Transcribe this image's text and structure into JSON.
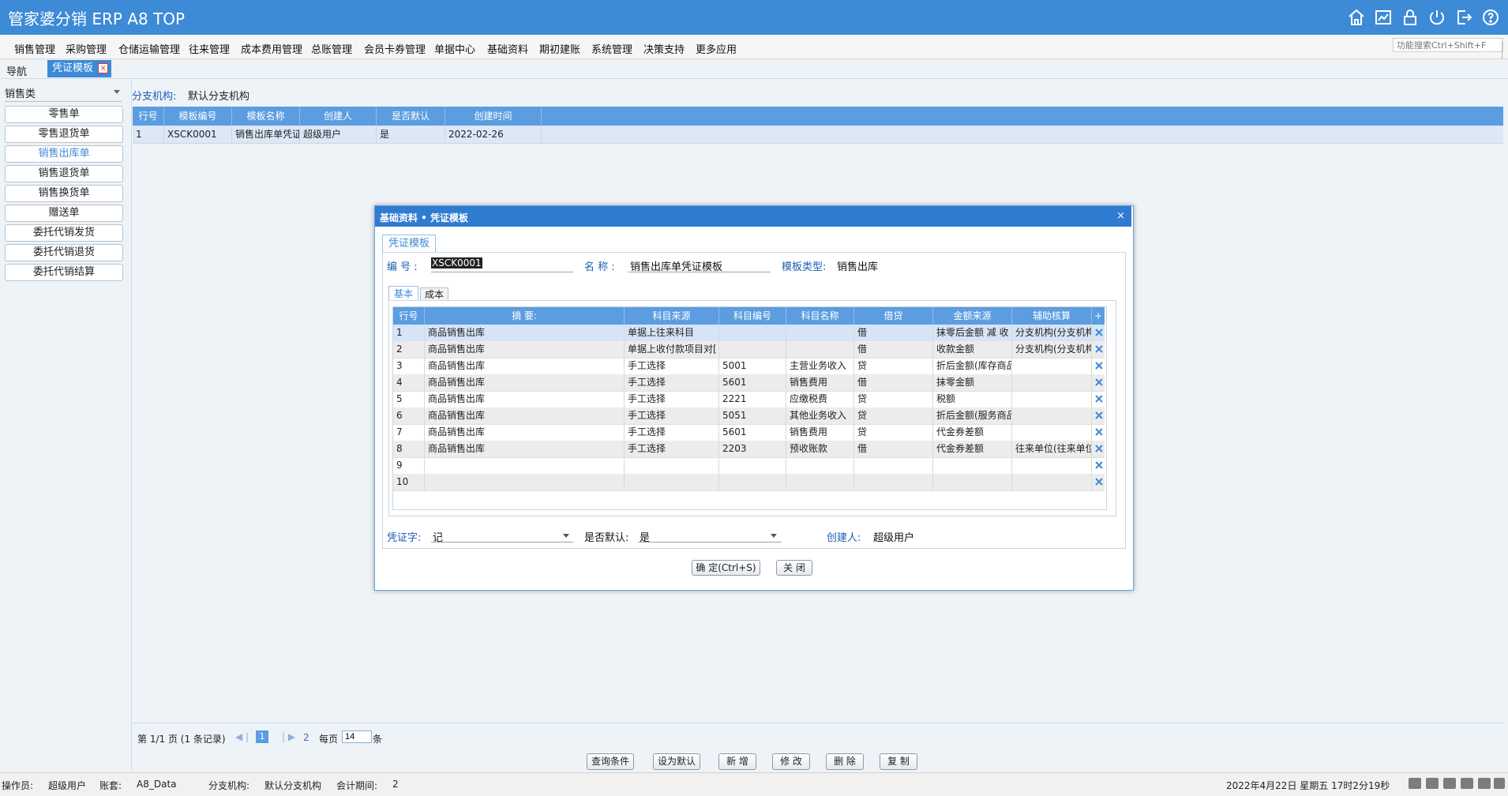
{
  "app": {
    "title": "管家婆分销 ERP A8 TOP"
  },
  "top_icons": [
    "home-icon",
    "chart-icon",
    "lock-icon",
    "power-icon",
    "exit-icon",
    "help-icon"
  ],
  "menu": [
    "销售管理",
    "采购管理",
    "仓储运输管理",
    "往来管理",
    "成本费用管理",
    "总账管理",
    "会员卡券管理",
    "单据中心",
    "基础资料",
    "期初建账",
    "系统管理",
    "决策支持",
    "更多应用"
  ],
  "search": {
    "placeholder": "功能搜索Ctrl+Shift+F"
  },
  "tabs": {
    "nav": "导航",
    "voucher": "凭证模板"
  },
  "left": {
    "category": "销售类",
    "buttons": [
      "零售单",
      "零售退货单",
      "销售出库单",
      "销售退货单",
      "销售换货单",
      "赠送单",
      "委托代销发货",
      "委托代销退货",
      "委托代销结算"
    ],
    "active_index": 2
  },
  "branch": {
    "label": "分支机构:",
    "value": "默认分支机构"
  },
  "grid": {
    "headers": [
      "行号",
      "模板编号",
      "模板名称",
      "创建人",
      "是否默认",
      "创建时间"
    ],
    "rows": [
      [
        "1",
        "XSCK0001",
        "销售出库单凭证",
        "超级用户",
        "是",
        "2022-02-26"
      ]
    ]
  },
  "pager": {
    "text": "第  1/1 页  (1 条记录)",
    "current": "1",
    "two": "2",
    "per_label": "每页",
    "per_value": "14",
    "unit": "条"
  },
  "bottom_buttons": [
    "查询条件",
    "设为默认",
    "新  增",
    "修  改",
    "删  除",
    "复  制"
  ],
  "status": {
    "operator_label": "操作员:",
    "operator": "超级用户",
    "account_label": "账套:",
    "account": "A8_Data",
    "branch_label": "分支机构:",
    "branch": "默认分支机构",
    "period_label": "会计期间:",
    "period": "2",
    "datetime": "2022年4月22日  星期五  17时2分19秒"
  },
  "dialog": {
    "title": "基础资料  •  凭证模板",
    "tab": "凭证模板",
    "code_label": "编 号 :",
    "code": "XSCK0001",
    "name_label": "名 称 :",
    "name": "销售出库单凭证模板",
    "type_label": "模板类型:",
    "type": "销售出库",
    "sub_tabs": [
      "基本",
      "成本"
    ],
    "headers": [
      "行号",
      "摘      要:",
      "科目来源",
      "科目编号",
      "科目名称",
      "借贷",
      "金额来源",
      "辅助核算",
      "+"
    ],
    "rows": [
      [
        "1",
        "商品销售出库",
        "单据上往来科目",
        "",
        "",
        "借",
        "抹零后金额  减 收",
        "分支机构(分支机构"
      ],
      [
        "2",
        "商品销售出库",
        "单据上收付款项目对[",
        "",
        "",
        "借",
        "收款金额",
        "分支机构(分支机构"
      ],
      [
        "3",
        "商品销售出库",
        "手工选择",
        "5001",
        "主营业务收入",
        "贷",
        "折后金额(库存商品",
        ""
      ],
      [
        "4",
        "商品销售出库",
        "手工选择",
        "5601",
        "销售费用",
        "借",
        "抹零金额",
        ""
      ],
      [
        "5",
        "商品销售出库",
        "手工选择",
        "2221",
        "应缴税费",
        "贷",
        "税额",
        ""
      ],
      [
        "6",
        "商品销售出库",
        "手工选择",
        "5051",
        "其他业务收入",
        "贷",
        "折后金额(服务商品",
        ""
      ],
      [
        "7",
        "商品销售出库",
        "手工选择",
        "5601",
        "销售费用",
        "贷",
        "代金券差额",
        ""
      ],
      [
        "8",
        "商品销售出库",
        "手工选择",
        "2203",
        "预收账款",
        "借",
        "代金券差额",
        "往来单位(往来单位"
      ],
      [
        "9",
        "",
        "",
        "",
        "",
        "",
        "",
        ""
      ],
      [
        "10",
        "",
        "",
        "",
        "",
        "",
        "",
        ""
      ]
    ],
    "voucher_label": "凭证字:",
    "voucher": "记",
    "default_label": "是否默认:",
    "default": "是",
    "creator_label": "创建人:",
    "creator": "超级用户",
    "ok": "确 定(Ctrl+S)",
    "close": "关  闭"
  },
  "colors": {
    "brand": "#3d8ad6",
    "header": "#5b9de0",
    "label": "#1e5db5"
  }
}
